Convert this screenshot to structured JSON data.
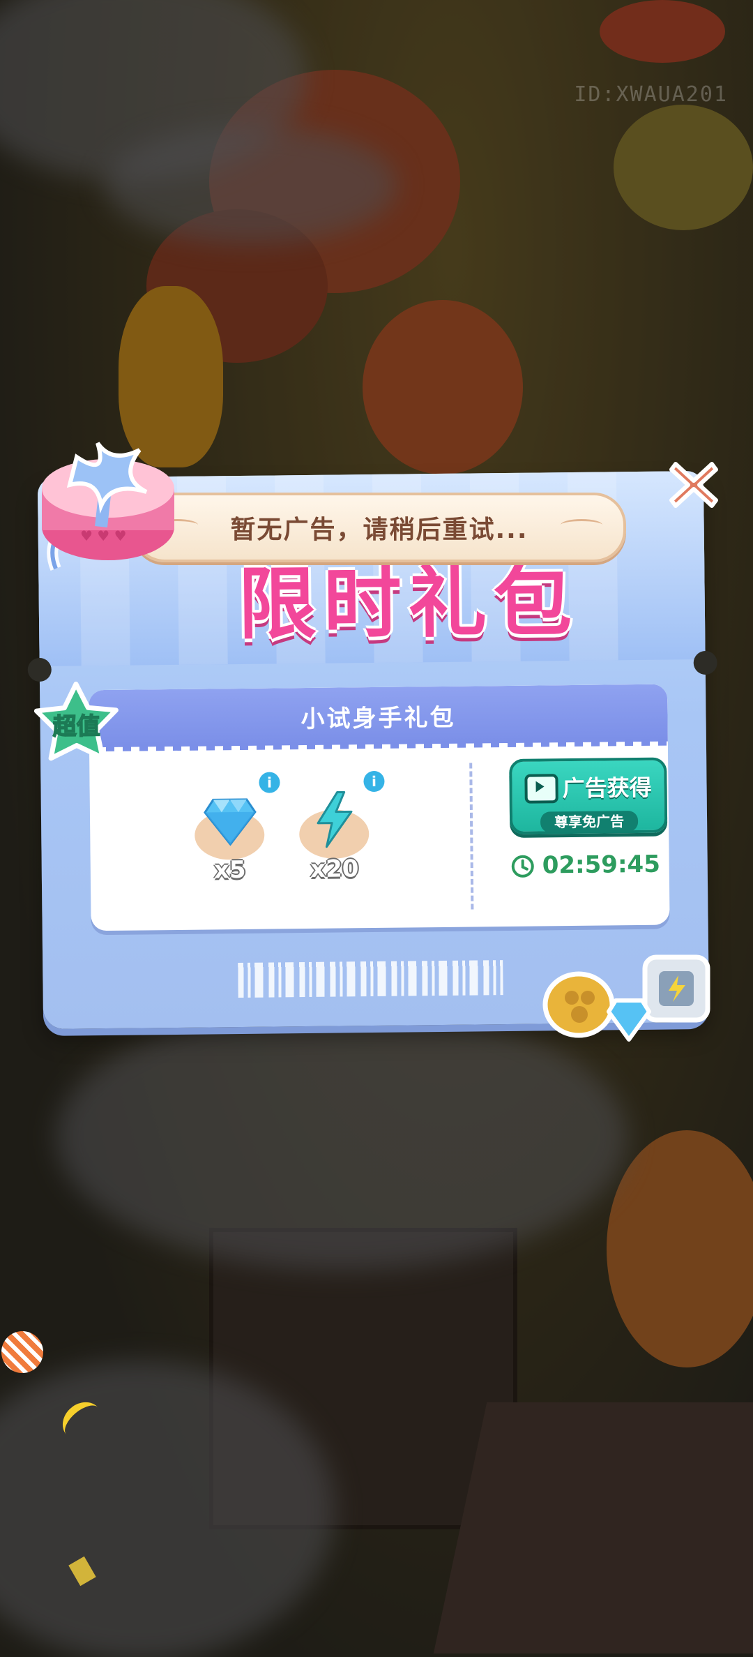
{
  "watermark": "ID:XWAUA201",
  "toast": {
    "message": "暂无广告，请稍后重试..."
  },
  "banner": {
    "title": "限时礼包"
  },
  "pack": {
    "name": "小试身手礼包",
    "badge": "超值",
    "items": [
      {
        "icon": "diamond-icon",
        "quantity": "x5",
        "info": "i"
      },
      {
        "icon": "lightning-icon",
        "quantity": "x20",
        "info": "i"
      }
    ],
    "ad_button": {
      "label": "广告获得",
      "sub_label": "尊享免广告"
    },
    "timer": "02:59:45"
  },
  "colors": {
    "accent": "#f2479a",
    "button": "#1eb69f",
    "timer": "#2d9c5e",
    "panel": "#a8c6f5"
  }
}
